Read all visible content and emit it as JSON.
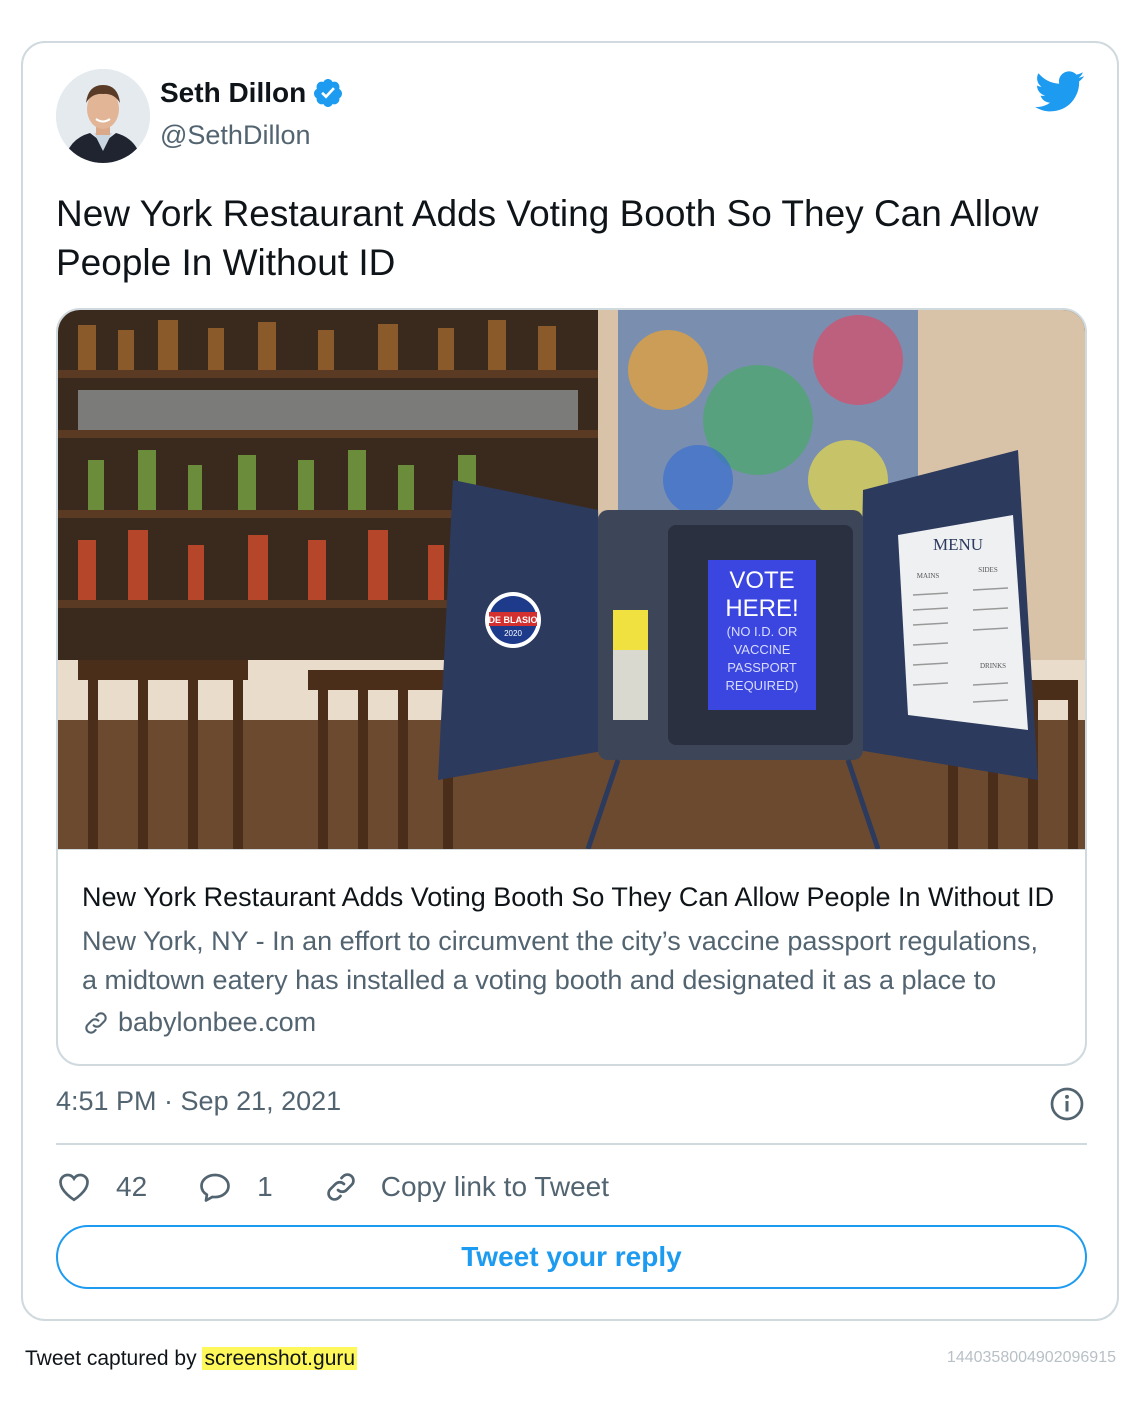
{
  "author": {
    "name": "Seth Dillon",
    "handle": "@SethDillon"
  },
  "tweet": {
    "text": "New York Restaurant Adds Voting Booth So They Can Allow People In Without ID",
    "timestamp": "4:51 PM · Sep 21, 2021"
  },
  "link_card": {
    "title": "New York Restaurant Adds Voting Booth So They Can Allow People In Without ID",
    "description": "New York, NY - In an effort to circumvent the city’s vaccine passport regulations, a midtown eatery has installed a voting booth and designated it as a place to vote...",
    "domain": "babylonbee.com",
    "image": {
      "screen_lines": [
        "VOTE",
        "HERE!",
        "(NO I.D. OR",
        "VACCINE",
        "PASSPORT",
        "REQUIRED)"
      ],
      "sticker_line1": "DE BLASIO",
      "sticker_line2": "2020",
      "menu_title": "MENU",
      "menu_sections": [
        "MAINS",
        "SIDES",
        "DRINKS"
      ]
    }
  },
  "actions": {
    "likes": "42",
    "replies": "1",
    "copy_label": "Copy link to Tweet",
    "reply_button": "Tweet your reply"
  },
  "footer": {
    "captured_prefix": "Tweet captured by",
    "captured_link": "screenshot.guru",
    "tweet_id": "1440358004902096915"
  },
  "colors": {
    "accent": "#1d9bf0",
    "border": "#cfd9de",
    "secondary_text": "#536471",
    "highlight": "#fff85a"
  },
  "icons": {
    "verified": "verified-badge-icon",
    "brand": "twitter-bird-icon",
    "like": "heart-icon",
    "reply": "speech-bubble-icon",
    "copy": "link-icon",
    "info": "info-icon"
  }
}
